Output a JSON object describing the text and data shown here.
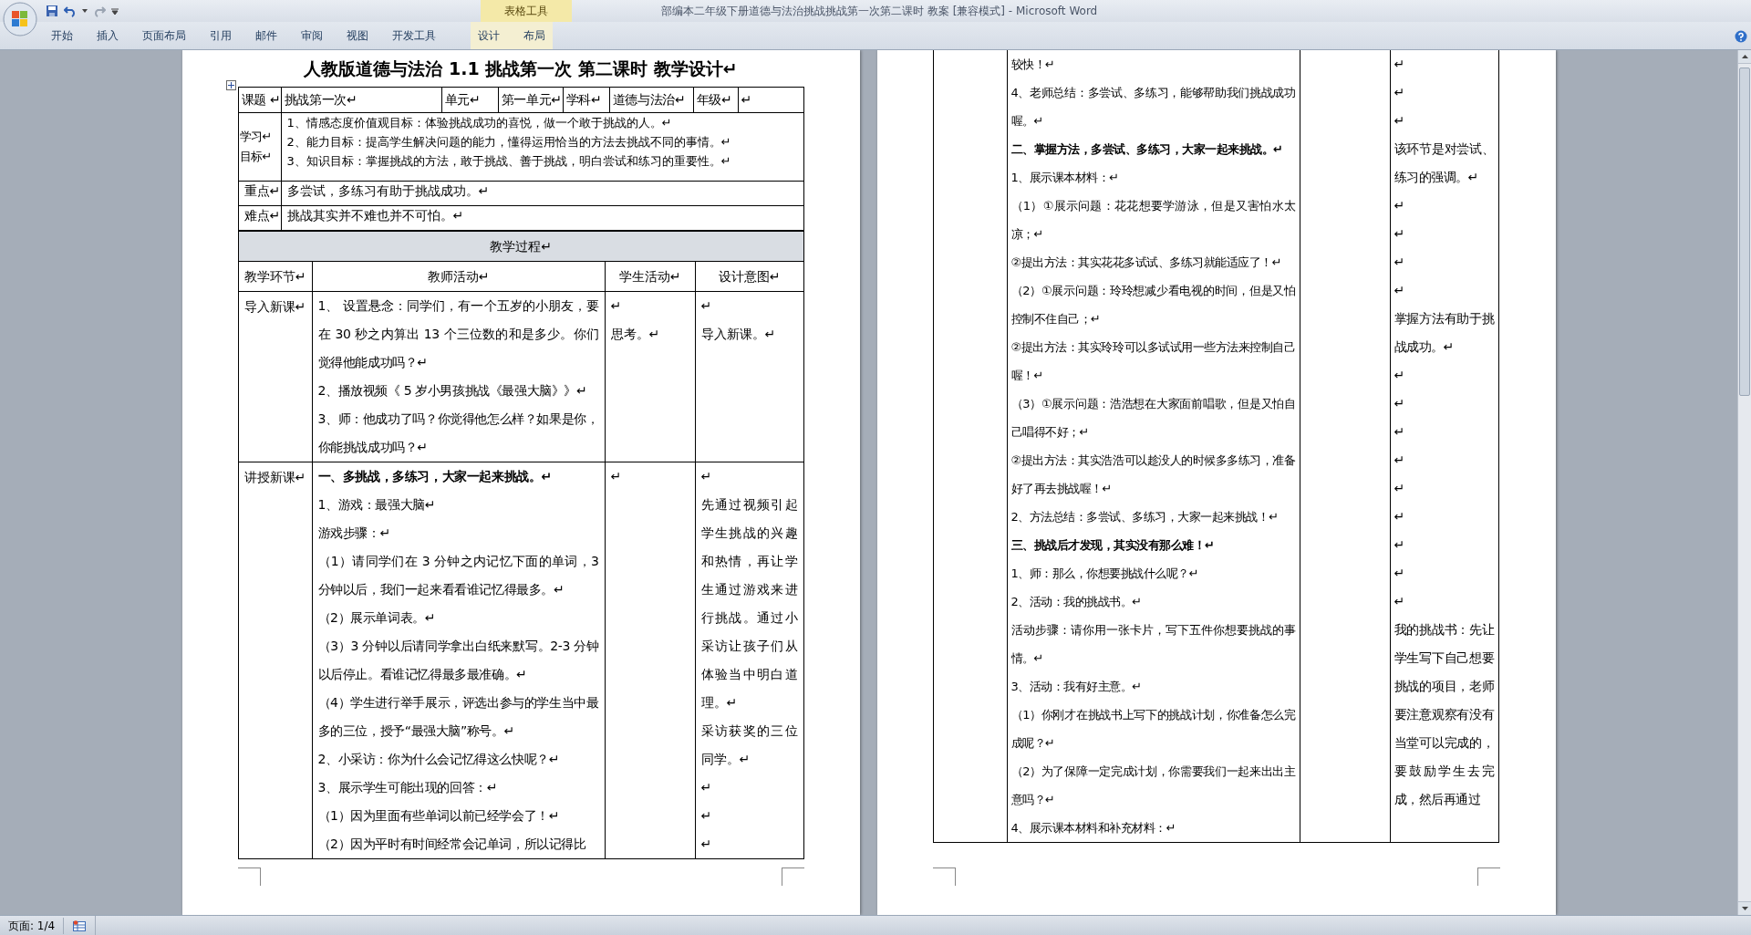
{
  "window": {
    "title": "部编本二年级下册道德与法治挑战挑战第一次第二课时 教案 [兼容模式] - Microsoft Word"
  },
  "ribbon": {
    "tabs": [
      "开始",
      "插入",
      "页面布局",
      "引用",
      "邮件",
      "审阅",
      "视图",
      "开发工具"
    ],
    "context_group": {
      "label": "表格工具",
      "tabs": [
        "设计",
        "布局"
      ]
    }
  },
  "left_page": {
    "title": "人教版道德与法治 1.1  挑战第一次  第二课时  教学设计↵",
    "info_row": [
      {
        "label": "课题 ↵",
        "value": "挑战第一次↵"
      },
      {
        "label": "单元↵",
        "value": "第一单元↵"
      },
      {
        "label": "学科↵",
        "value": "道德与法治↵"
      },
      {
        "label": "年级↵",
        "value": "↵"
      }
    ],
    "goals": {
      "label": "学习↵目标↵",
      "lines": [
        "1、情感态度价值观目标：体验挑战成功的喜悦，做一个敢于挑战的人。↵",
        "2、能力目标：提高学生解决问题的能力，懂得运用恰当的方法去挑战不同的事情。↵",
        "3、知识目标：掌握挑战的方法，敢于挑战、善于挑战，明白尝试和练习的重要性。↵"
      ]
    },
    "key_point": {
      "label": "重点↵",
      "text": "多尝试，多练习有助于挑战成功。↵"
    },
    "difficulty": {
      "label": "难点↵",
      "text": "挑战其实并不难也并不可怕。↵"
    },
    "process": {
      "title": "教学过程↵",
      "columns": [
        "教学环节↵",
        "教师活动↵",
        "学生活动↵",
        "设计意图↵"
      ],
      "rows": [
        {
          "stage": "导入新课↵",
          "teacher": [
            {
              "text": "1、 设置悬念：同学们，有一个五岁的小朋友，要在 30 秒之内算出 13 个三位数的和是多少。你们觉得他能成功吗？↵",
              "bold": false
            },
            {
              "text": "2、播放视频《 5 岁小男孩挑战《最强大脑》》↵",
              "bold": false
            },
            {
              "text": "3、师：他成功了吗？你觉得他怎么样？如果是你，你能挑战成功吗？↵",
              "bold": false
            }
          ],
          "student": [
            "↵",
            "思考。↵"
          ],
          "intent": [
            "↵",
            "导入新课。↵"
          ]
        },
        {
          "stage": "讲授新课↵",
          "teacher": [
            {
              "text": "一、多挑战，多练习，大家一起来挑战。↵",
              "bold": true
            },
            {
              "text": "1、游戏：最强大脑↵",
              "bold": false
            },
            {
              "text": "游戏步骤：↵",
              "bold": false
            },
            {
              "text": "（1）请同学们在 3 分钟之内记忆下面的单词，3 分钟以后，我们一起来看看谁记忆得最多。↵",
              "bold": false
            },
            {
              "text": "（2）展示单词表。↵",
              "bold": false
            },
            {
              "text": "（3）3 分钟以后请同学拿出白纸来默写。2-3 分钟以后停止。看谁记忆得最多最准确。↵",
              "bold": false
            },
            {
              "text": "（4）学生进行举手展示，评选出参与的学生当中最多的三位，授予“最强大脑”称号。↵",
              "bold": false
            },
            {
              "text": "2、小采访：你为什么会记忆得这么快呢？↵",
              "bold": false
            },
            {
              "text": "3、展示学生可能出现的回答：↵",
              "bold": false
            },
            {
              "text": "（1）因为里面有些单词以前已经学会了！↵",
              "bold": false
            },
            {
              "text": "（2）因为平时有时间经常会记单词，所以记得比",
              "bold": false
            }
          ],
          "student": [
            "↵"
          ],
          "intent": [
            "↵",
            "先通过视频引起学生挑战的兴趣和热情，再让学生通过游戏来进行挑战。通过小采访让孩子们从体验当中明白道理。↵",
            "采访获奖的三位同学。↵",
            "↵",
            "↵",
            "↵"
          ]
        }
      ]
    }
  },
  "right_page": {
    "teacher": [
      {
        "text": "较快！↵",
        "bold": false
      },
      {
        "text": "4、老师总结：多尝试、多练习，能够帮助我们挑战成功喔。↵",
        "bold": false
      },
      {
        "text": "二、掌握方法，多尝试、多练习，大家一起来挑战。↵",
        "bold": true
      },
      {
        "text": "1、展示课本材料：↵",
        "bold": false
      },
      {
        "text": "（1）①展示问题：花花想要学游泳，但是又害怕水太凉；↵",
        "bold": false
      },
      {
        "text": "②提出方法：其实花花多试试、多练习就能适应了！↵",
        "bold": false
      },
      {
        "text": "（2）①展示问题：玲玲想减少看电视的时间，但是又怕控制不住自己；↵",
        "bold": false
      },
      {
        "text": "②提出方法：其实玲玲可以多试试用一些方法来控制自己喔！↵",
        "bold": false
      },
      {
        "text": "（3）①展示问题：浩浩想在大家面前唱歌，但是又怕自己唱得不好；↵",
        "bold": false
      },
      {
        "text": "②提出方法：其实浩浩可以趁没人的时候多多练习，准备好了再去挑战喔！↵",
        "bold": false
      },
      {
        "text": "2、方法总结：多尝试、多练习，大家一起来挑战！↵",
        "bold": false
      },
      {
        "text": "三、挑战后才发现，其实没有那么难！↵",
        "bold": true
      },
      {
        "text": "1、师：那么，你想要挑战什么呢？↵",
        "bold": false
      },
      {
        "text": "2、活动：我的挑战书。↵",
        "bold": false
      },
      {
        "text": "活动步骤：请你用一张卡片，写下五件你想要挑战的事情。↵",
        "bold": false
      },
      {
        "text": "3、活动：我有好主意。↵",
        "bold": false
      },
      {
        "text": "（1）你刚才在挑战书上写下的挑战计划，你准备怎么完成呢？↵",
        "bold": false
      },
      {
        "text": "（2）为了保障一定完成计划，你需要我们一起来出出主意吗？↵",
        "bold": false
      },
      {
        "text": "4、展示课本材料和补充材料：↵",
        "bold": false
      }
    ],
    "intent": [
      "↵",
      "↵",
      "↵",
      "该环节是对尝试、练习的强调。↵",
      "↵",
      "↵",
      "↵",
      "↵",
      "掌握方法有助于挑战成功。↵",
      "↵",
      "↵",
      "↵",
      "↵",
      "↵",
      "↵",
      "↵",
      "↵",
      "↵",
      "我的挑战书：先让学生写下自己想要挑战的项目，老师要注意观察有没有当堂可以完成的，要鼓励学生去完成，然后再通过"
    ]
  },
  "status_bar": {
    "page": "页面: 1/4"
  }
}
